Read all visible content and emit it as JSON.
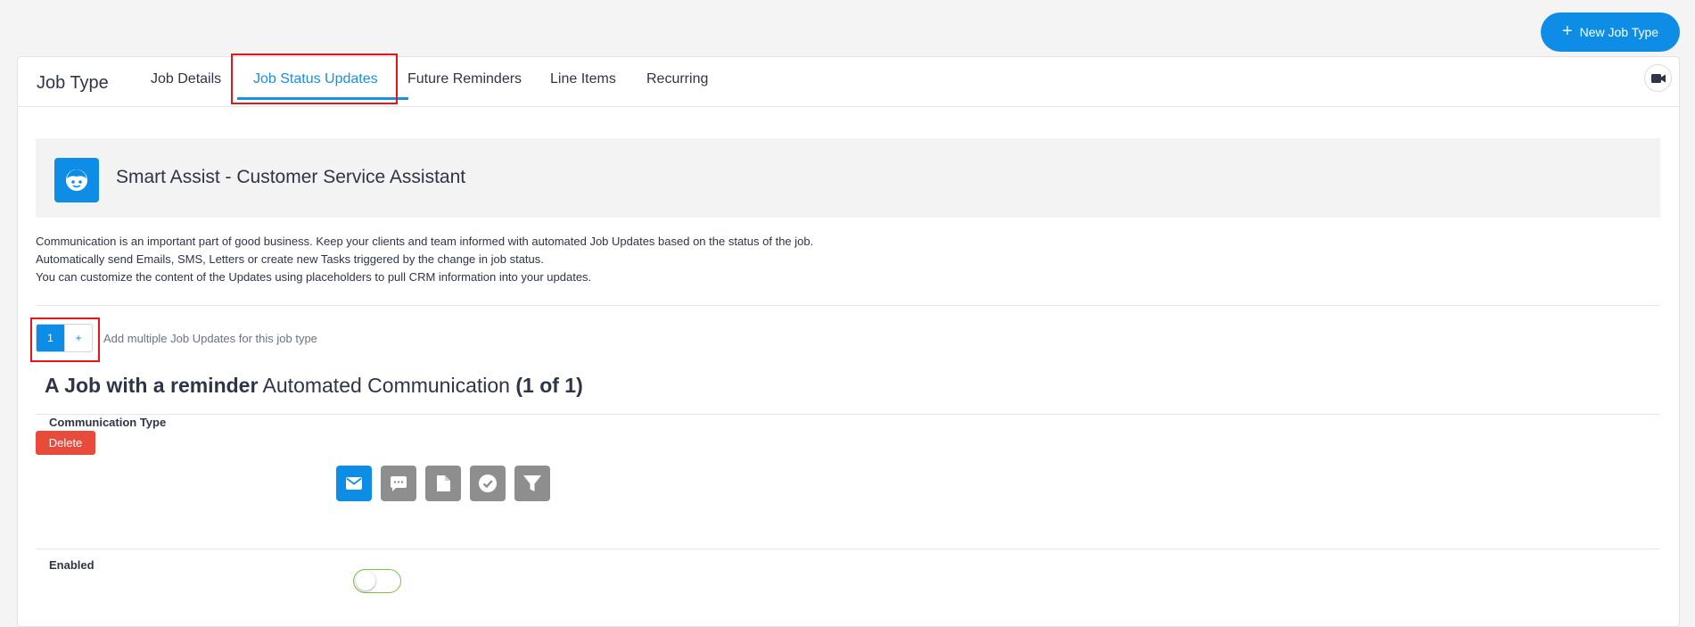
{
  "header": {
    "new_button_label": "New Job Type"
  },
  "card": {
    "title": "Job Type"
  },
  "tabs": [
    {
      "label": "Job Details",
      "active": false
    },
    {
      "label": "Job Status Updates",
      "active": true
    },
    {
      "label": "Future Reminders",
      "active": false
    },
    {
      "label": "Line Items",
      "active": false
    },
    {
      "label": "Recurring",
      "active": false
    }
  ],
  "assist": {
    "title": "Smart Assist - Customer Service Assistant"
  },
  "description": [
    "Communication is an important part of good business. Keep your clients and team informed with automated Job Updates based on the status of the job.",
    "Automatically send Emails, SMS, Letters or create new Tasks triggered by the change in job status.",
    "You can customize the content of the Updates using placeholders to pull CRM information into your updates."
  ],
  "pager": {
    "current": "1",
    "add_label": "+",
    "note": "Add multiple Job Updates for this job type"
  },
  "section": {
    "name": "A Job with a reminder",
    "subtitle": "Automated Communication",
    "count": "(1 of 1)"
  },
  "delete_label": "Delete",
  "form": {
    "communication_type_label": "Communication Type",
    "communication_types": [
      {
        "icon": "email-icon",
        "selected": true
      },
      {
        "icon": "sms-icon",
        "selected": false
      },
      {
        "icon": "letter-icon",
        "selected": false
      },
      {
        "icon": "task-icon",
        "selected": false
      },
      {
        "icon": "filter-icon",
        "selected": false
      }
    ],
    "enabled_label": "Enabled",
    "enabled": false
  },
  "colors": {
    "accent": "#0d8de6",
    "danger": "#e84a3c",
    "highlight": "#e8141b",
    "toggle_border": "#7cc24a"
  }
}
